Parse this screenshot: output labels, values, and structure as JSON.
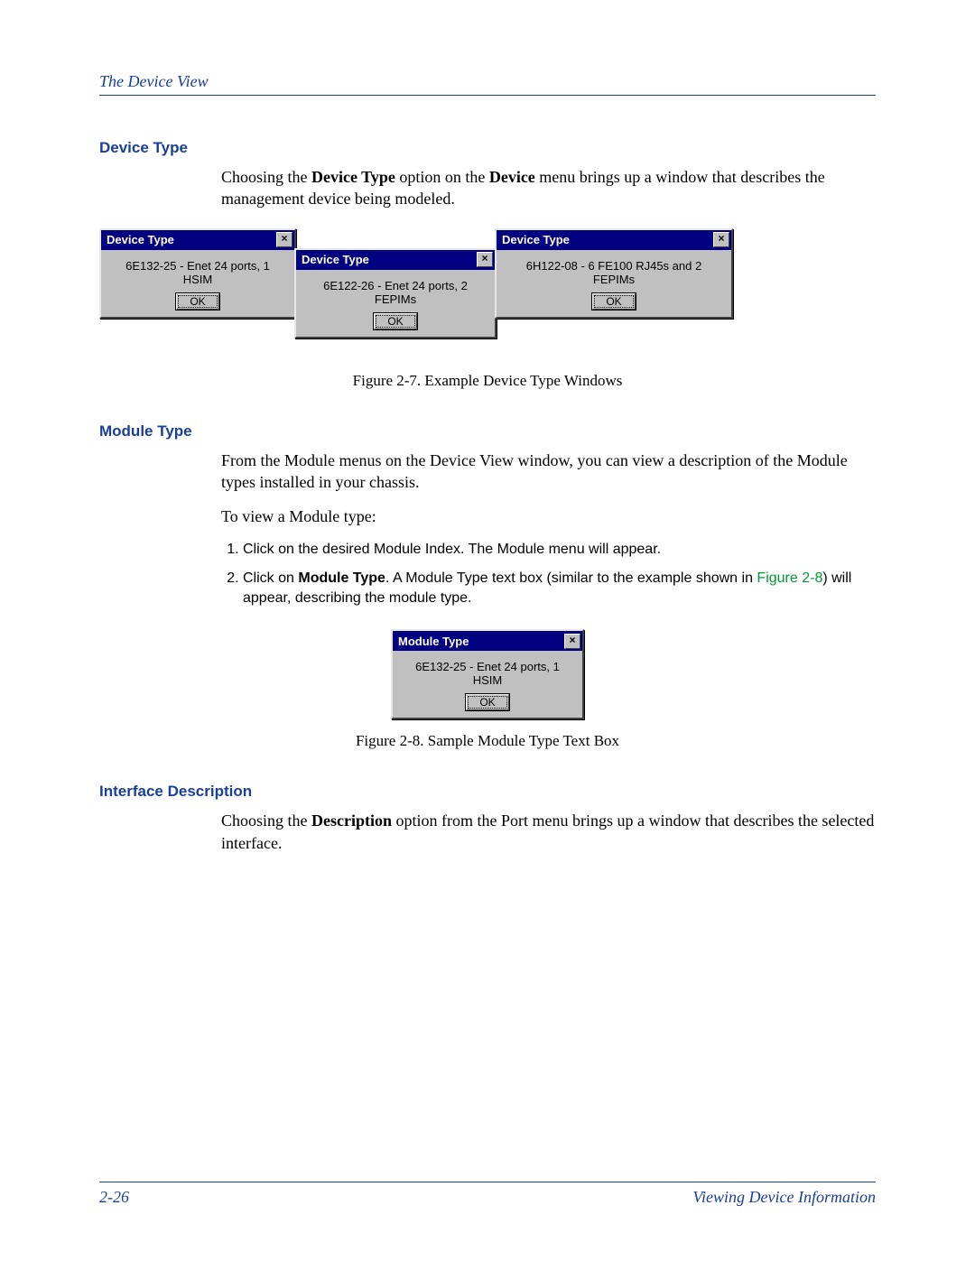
{
  "header": {
    "title": "The Device View"
  },
  "sections": {
    "deviceType": {
      "heading": "Device Type",
      "para_pre": "Choosing the ",
      "para_bold1": "Device Type",
      "para_mid1": " option on the ",
      "para_bold2": "Device",
      "para_post": " menu brings up a window that describes the management device being modeled."
    },
    "moduleType": {
      "heading": "Module Type",
      "para1": "From the Module menus on the Device View window, you can view a description of the Module types installed in your chassis.",
      "para2": "To view a Module type:",
      "step1": "Click on the desired Module Index. The Module menu will appear.",
      "step2_pre": "Click on ",
      "step2_bold": "Module Type",
      "step2_mid": ". A Module Type text box (similar to the example shown in ",
      "step2_figref": "Figure 2-8",
      "step2_post": ") will appear, describing the module type."
    },
    "interfaceDesc": {
      "heading": "Interface Description",
      "para_pre": "Choosing the ",
      "para_bold": "Description",
      "para_post": " option from the Port menu brings up a window that describes the selected interface."
    }
  },
  "figures": {
    "fig27": {
      "caption": "Figure 2-7. Example Device Type Windows",
      "dlg1": {
        "title": "Device Type",
        "body": "6E132-25 - Enet 24 ports, 1 HSIM",
        "ok": "OK",
        "close": "×"
      },
      "dlg2": {
        "title": "Device Type",
        "body": "6E122-26 - Enet 24 ports, 2 FEPIMs",
        "ok": "OK",
        "close": "×"
      },
      "dlg3": {
        "title": "Device Type",
        "body": "6H122-08 - 6 FE100 RJ45s and 2 FEPIMs",
        "ok": "OK",
        "close": "×"
      }
    },
    "fig28": {
      "caption": "Figure 2-8. Sample Module Type Text Box",
      "dlg": {
        "title": "Module Type",
        "body": "6E132-25 - Enet 24 ports, 1 HSIM",
        "ok": "OK",
        "close": "×"
      }
    }
  },
  "footer": {
    "page": "2-26",
    "section": "Viewing Device Information"
  }
}
